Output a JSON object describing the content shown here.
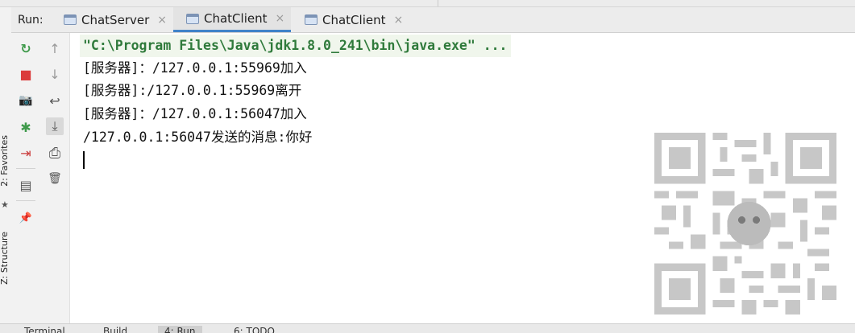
{
  "run_panel": {
    "label": "Run:",
    "tabs": [
      {
        "label": "ChatServer",
        "close": "×"
      },
      {
        "label": "ChatClient",
        "close": "×"
      },
      {
        "label": "ChatClient",
        "close": "×"
      }
    ],
    "active_tab_index": 1
  },
  "left_stripe": {
    "favorites": "2: Favorites",
    "structure": "Z: Structure",
    "star": "★"
  },
  "toolbar_primary": [
    {
      "name": "rerun-icon",
      "glyph": "↻",
      "color": "#3f9a4b"
    },
    {
      "name": "stop-icon",
      "glyph": "■",
      "color": "#db3b3b"
    },
    {
      "name": "camera-icon",
      "glyph": "📷",
      "color": "#555555"
    },
    {
      "name": "debug-bug-icon",
      "glyph": "✱",
      "color": "#3f9a4b"
    },
    {
      "name": "exit-icon",
      "glyph": "⇥",
      "color": "#c93939"
    },
    {
      "name": "layout-icon",
      "glyph": "▤",
      "color": "#555555"
    },
    {
      "name": "pin-icon",
      "glyph": "📌",
      "color": "#555555"
    }
  ],
  "toolbar_secondary": [
    {
      "name": "arrow-up-icon",
      "glyph": "↑",
      "color": "#9a9a9a"
    },
    {
      "name": "arrow-down-icon",
      "glyph": "↓",
      "color": "#9a9a9a"
    },
    {
      "name": "soft-wrap-icon",
      "glyph": "↩",
      "color": "#555555"
    },
    {
      "name": "scroll-to-end-icon",
      "glyph": "⤓",
      "color": "#555555"
    },
    {
      "name": "print-icon",
      "glyph": "⎙",
      "color": "#555555"
    },
    {
      "name": "trash-icon",
      "glyph": "🗑",
      "color": "#555555"
    }
  ],
  "console": {
    "command": "\"C:\\Program Files\\Java\\jdk1.8.0_241\\bin\\java.exe\" ...",
    "lines": [
      "[服务器]：/127.0.0.1:55969加入",
      "[服务器]:/127.0.0.1:55969离开",
      "[服务器]：/127.0.0.1:56047加入",
      "/127.0.0.1:56047发送的消息:你好"
    ]
  },
  "bottom_bar": {
    "items": [
      "Terminal",
      "Build",
      "4: Run",
      "6: TODO"
    ],
    "active_index": 2
  },
  "colors": {
    "accent": "#4083c9",
    "command_text": "#2f7a3b"
  }
}
